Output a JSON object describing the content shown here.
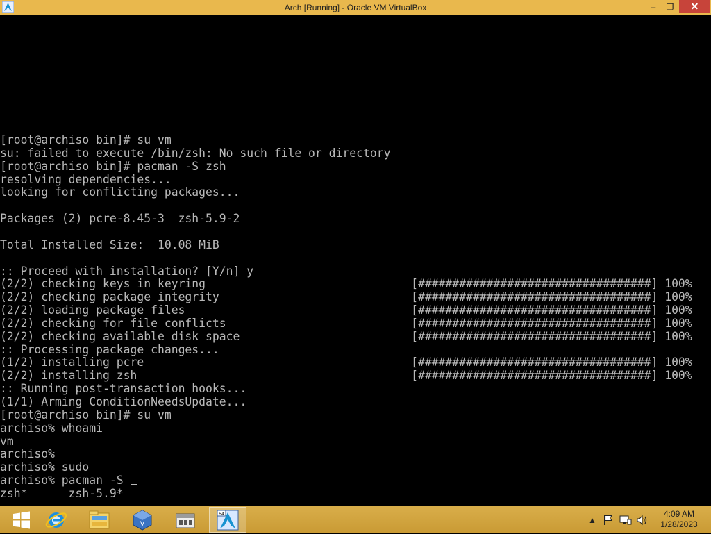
{
  "window": {
    "title": "Arch [Running] - Oracle VM VirtualBox",
    "controls": {
      "minimize": "–",
      "maximize": "❐",
      "close": "✕"
    }
  },
  "terminal": {
    "lines": [
      "[root@archiso bin]# su vm",
      "su: failed to execute /bin/zsh: No such file or directory",
      "[root@archiso bin]# pacman -S zsh",
      "resolving dependencies...",
      "looking for conflicting packages...",
      "",
      "Packages (2) pcre-8.45-3  zsh-5.9-2",
      "",
      "Total Installed Size:  10.08 MiB",
      "",
      ":: Proceed with installation? [Y/n] y",
      "(2/2) checking keys in keyring                              [##################################] 100%",
      "(2/2) checking package integrity                            [##################################] 100%",
      "(2/2) loading package files                                 [##################################] 100%",
      "(2/2) checking for file conflicts                           [##################################] 100%",
      "(2/2) checking available disk space                         [##################################] 100%",
      ":: Processing package changes...",
      "(1/2) installing pcre                                       [##################################] 100%",
      "(2/2) installing zsh                                        [##################################] 100%",
      ":: Running post-transaction hooks...",
      "(1/1) Arming ConditionNeedsUpdate...",
      "[root@archiso bin]# su vm",
      "archiso% whoami",
      "vm",
      "archiso%",
      "archiso% sudo",
      "archiso% pacman -S ",
      "zsh*      zsh-5.9*"
    ],
    "colors": {
      "background": "#000000",
      "text": "#b8b8b8"
    }
  },
  "taskbar": {
    "apps": [
      {
        "name": "internet-explorer-icon"
      },
      {
        "name": "file-explorer-icon"
      },
      {
        "name": "virtualbox-icon"
      },
      {
        "name": "store-icon"
      },
      {
        "name": "arch-vm-icon",
        "badge": "64"
      }
    ],
    "tray": {
      "show_hidden": "▲"
    },
    "clock": {
      "time": "4:09 AM",
      "date": "1/28/2023"
    }
  },
  "colors": {
    "titlebar": "#e9b84d",
    "taskbar": "#d3a640",
    "close": "#c7443a"
  }
}
